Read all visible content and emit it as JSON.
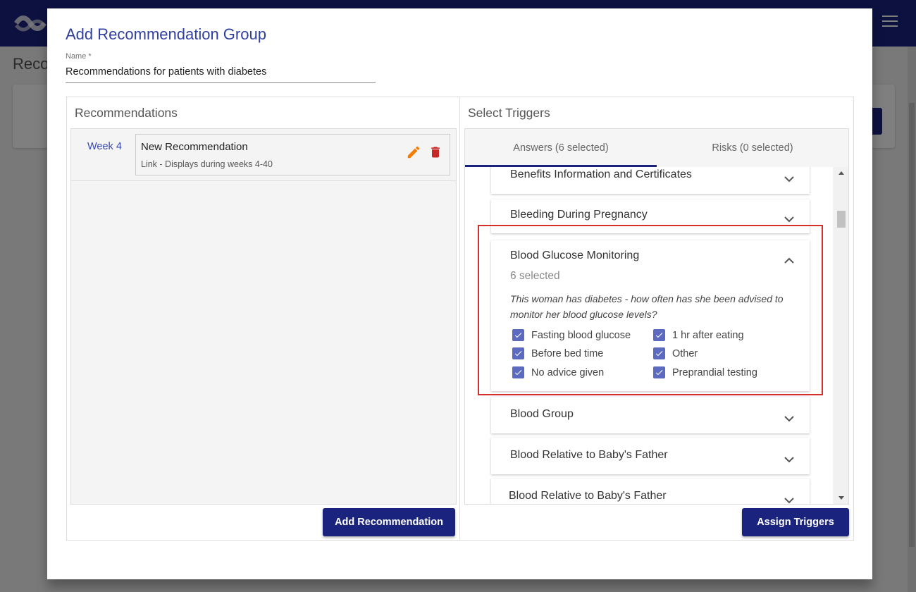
{
  "background": {
    "page_title_partial": "Reco"
  },
  "dialog": {
    "title": "Add Recommendation Group",
    "name_label": "Name *",
    "name_value": "Recommendations for patients with diabetes"
  },
  "recommendations": {
    "title": "Recommendations",
    "items": [
      {
        "week": "Week 4",
        "name": "New Recommendation",
        "subtitle": "Link - Displays during weeks 4-40"
      }
    ],
    "add_button": "Add Recommendation"
  },
  "triggers": {
    "title": "Select Triggers",
    "tabs": [
      {
        "label": "Answers (6 selected)",
        "active": true
      },
      {
        "label": "Risks (0 selected)",
        "active": false
      }
    ],
    "sections": [
      {
        "title": "Benefits Information and Certificates",
        "expanded": false
      },
      {
        "title": "Bleeding During Pregnancy",
        "expanded": false
      },
      {
        "title": "Blood Glucose Monitoring",
        "expanded": true,
        "subtitle": "6 selected",
        "question": "This woman has diabetes - how often has she been advised to monitor her blood glucose levels?",
        "options": [
          {
            "label": "Fasting blood glucose",
            "checked": true
          },
          {
            "label": "1 hr after eating",
            "checked": true
          },
          {
            "label": "Before bed time",
            "checked": true
          },
          {
            "label": "Other",
            "checked": true
          },
          {
            "label": "No advice given",
            "checked": true
          },
          {
            "label": "Preprandial testing",
            "checked": true
          }
        ]
      },
      {
        "title": "Blood Group",
        "expanded": false
      },
      {
        "title": "Blood Relative to Baby's Father",
        "expanded": false
      },
      {
        "title": "Blood Relative to Baby's Father",
        "expanded": false
      }
    ],
    "assign_button": "Assign Triggers"
  },
  "colors": {
    "primary": "#1a237e",
    "checkbox": "#5c6bc0",
    "edit_icon": "#f57c00",
    "delete_icon": "#c62828",
    "highlight": "#d32f2f"
  }
}
